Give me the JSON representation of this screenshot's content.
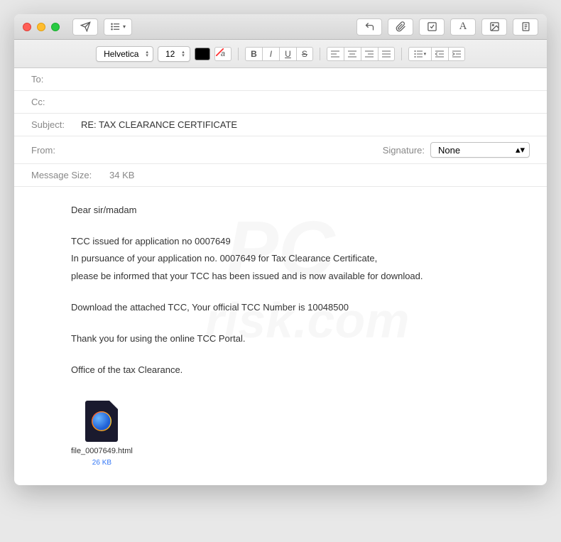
{
  "toolbar": {
    "font": "Helvetica",
    "size": "12"
  },
  "headers": {
    "to_label": "To:",
    "to_value": "",
    "cc_label": "Cc:",
    "cc_value": "",
    "subject_label": "Subject:",
    "subject_value": "RE: TAX CLEARANCE CERTIFICATE",
    "from_label": "From:",
    "from_value": "",
    "signature_label": "Signature:",
    "signature_value": "None",
    "size_label": "Message Size:",
    "size_value": "34 KB"
  },
  "body": {
    "greeting": "Dear sir/madam",
    "line1": "TCC issued for application no 0007649",
    "line2": "In pursuance of your application no. 0007649 for Tax Clearance Certificate,",
    "line3": "please be informed that your TCC has been issued and is now available for download.",
    "line4": "Download the attached TCC, Your official TCC Number is 10048500",
    "line5": "Thank you for using the online TCC Portal.",
    "line6": "Office of the tax Clearance."
  },
  "attachment": {
    "name": "file_0007649.html",
    "size": "26 KB"
  },
  "watermark": {
    "brand": "PC",
    "domain": "risk.com"
  }
}
